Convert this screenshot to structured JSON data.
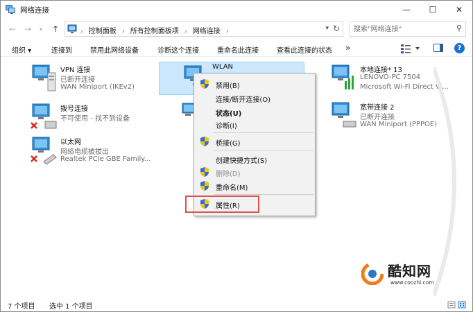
{
  "window": {
    "title": "网络连接",
    "controls": {
      "minimize": "—",
      "maximize": "☐",
      "close": "✕"
    }
  },
  "address": {
    "back_icon": "arrow-left-icon",
    "forward_icon": "arrow-right-icon",
    "breadcrumbs": [
      "控制面板",
      "所有控制面板项",
      "网络连接"
    ],
    "search_placeholder": "搜索\"网络连接\""
  },
  "toolbar": {
    "organize": "组织 ▾",
    "connect_to": "连接到",
    "disable_device": "禁用此网络设备",
    "diagnose": "诊断这个连接",
    "rename": "重命名此连接",
    "view_status": "查看此连接的状态",
    "more": "»",
    "help": "?"
  },
  "connections": [
    {
      "name": "VPN 连接",
      "status": "已断开连接",
      "device": "WAN Miniport (IKEv2)",
      "icon": "vpn-adapter-icon"
    },
    {
      "name": "WLAN",
      "status": "",
      "device": "",
      "icon": "wifi-adapter-icon"
    },
    {
      "name": "本地连接* 13",
      "status": "LENOVO-PC 7504",
      "device": "Microsoft Wi-Fi Direct Vi...",
      "icon": "network-adapter-icon"
    },
    {
      "name": "拨号连接",
      "status": "不可使用 - 找不到设备",
      "device": "",
      "icon": "dialup-modem-icon"
    },
    {
      "name": "宽带连接 2",
      "status": "已断开连接",
      "device": "WAN Miniport (PPPOE)",
      "icon": "broadband-adapter-icon"
    },
    {
      "name": "以太网",
      "status": "网络电缆被拔出",
      "device": "Realtek PCIe GBE Family...",
      "icon": "ethernet-adapter-icon"
    }
  ],
  "context_menu": {
    "items": [
      {
        "label": "禁用(B)",
        "shield": true
      },
      {
        "label": "连接/断开连接(O)",
        "shield": false
      },
      {
        "label": "状态(U)",
        "shield": false,
        "bold": true
      },
      {
        "label": "诊断(I)",
        "shield": false
      },
      {
        "label": "桥接(G)",
        "shield": true
      },
      {
        "label": "创建快捷方式(S)",
        "shield": false
      },
      {
        "label": "删除(D)",
        "shield": true,
        "disabled": true
      },
      {
        "label": "重命名(M)",
        "shield": true
      },
      {
        "label": "属性(R)",
        "shield": true
      }
    ]
  },
  "statusbar": {
    "item_count": "7 个项目",
    "selected_count": "选中 1 个项目"
  },
  "watermark": {
    "name": "酷知网",
    "url": "www.coozhi.com"
  },
  "colors": {
    "selection_bg": "#cce8ff",
    "selection_border": "#99d1ff",
    "highlight_box": "#d9534f",
    "help_blue": "#1c6ed0",
    "error_red": "#d6281f"
  }
}
